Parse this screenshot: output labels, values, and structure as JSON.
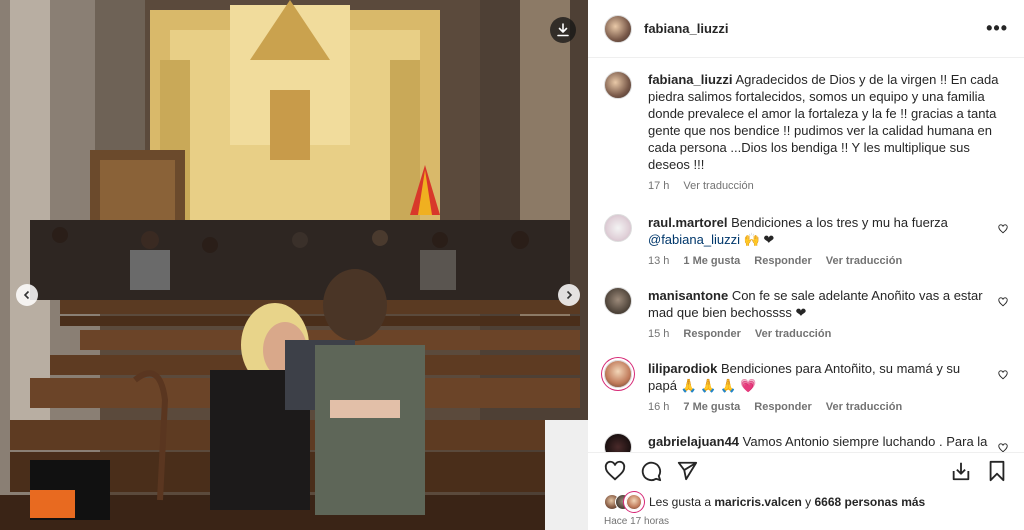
{
  "post": {
    "username": "fabiana_liuzzi",
    "caption": "Agradecidos de Dios y de la virgen !! En cada piedra salimos fortalecidos, somos un equipo y una familia donde prevalece el amor la fortaleza y la fe !! gracias a tanta gente que nos bendice !! pudimos ver la calidad humana en cada persona ...Dios los bendiga !! Y les multiplique sus deseos !!!",
    "caption_time": "17 h",
    "see_translation": "Ver traducción"
  },
  "comments": [
    {
      "username": "raul.martorel",
      "text": "Bendiciones a los tres y mu ha fuerza",
      "mention": "@fabiana_liuzzi",
      "emoji": "🙌 ❤",
      "time": "13 h",
      "likes": "1 Me gusta",
      "reply": "Responder",
      "translate": "Ver traducción"
    },
    {
      "username": "manisantone",
      "text": "Con fe se sale adelante Anoñito vas a estar mad que bien bechossss",
      "emoji": "❤",
      "time": "15 h",
      "reply": "Responder",
      "translate": "Ver traducción"
    },
    {
      "username": "liliparodiok",
      "text": "Bendiciones para Antoñito, su mamá y su papá",
      "emoji": "🙏 🙏 🙏 💗",
      "time": "16 h",
      "likes": "7 Me gusta",
      "reply": "Responder",
      "translate": "Ver traducción"
    },
    {
      "username": "gabrielajuan44",
      "text": "Vamos Antonio siempre luchando . Para la mamá luchadora dios siempre los va a cuidar y proteger.",
      "emoji": "❤",
      "time": "",
      "reply": "",
      "translate": ""
    }
  ],
  "likes": {
    "prefix": "Les gusta a",
    "user": "maricris.valcen",
    "joiner": "y",
    "count": "6668 personas más"
  },
  "timestamp": "Hace 17 horas",
  "icons": {
    "download": "download-icon",
    "prev": "chevron-left-icon",
    "next": "chevron-right-icon",
    "more": "more-options-icon",
    "like": "heart-icon",
    "comment": "comment-icon",
    "share": "share-icon",
    "save": "bookmark-icon"
  }
}
